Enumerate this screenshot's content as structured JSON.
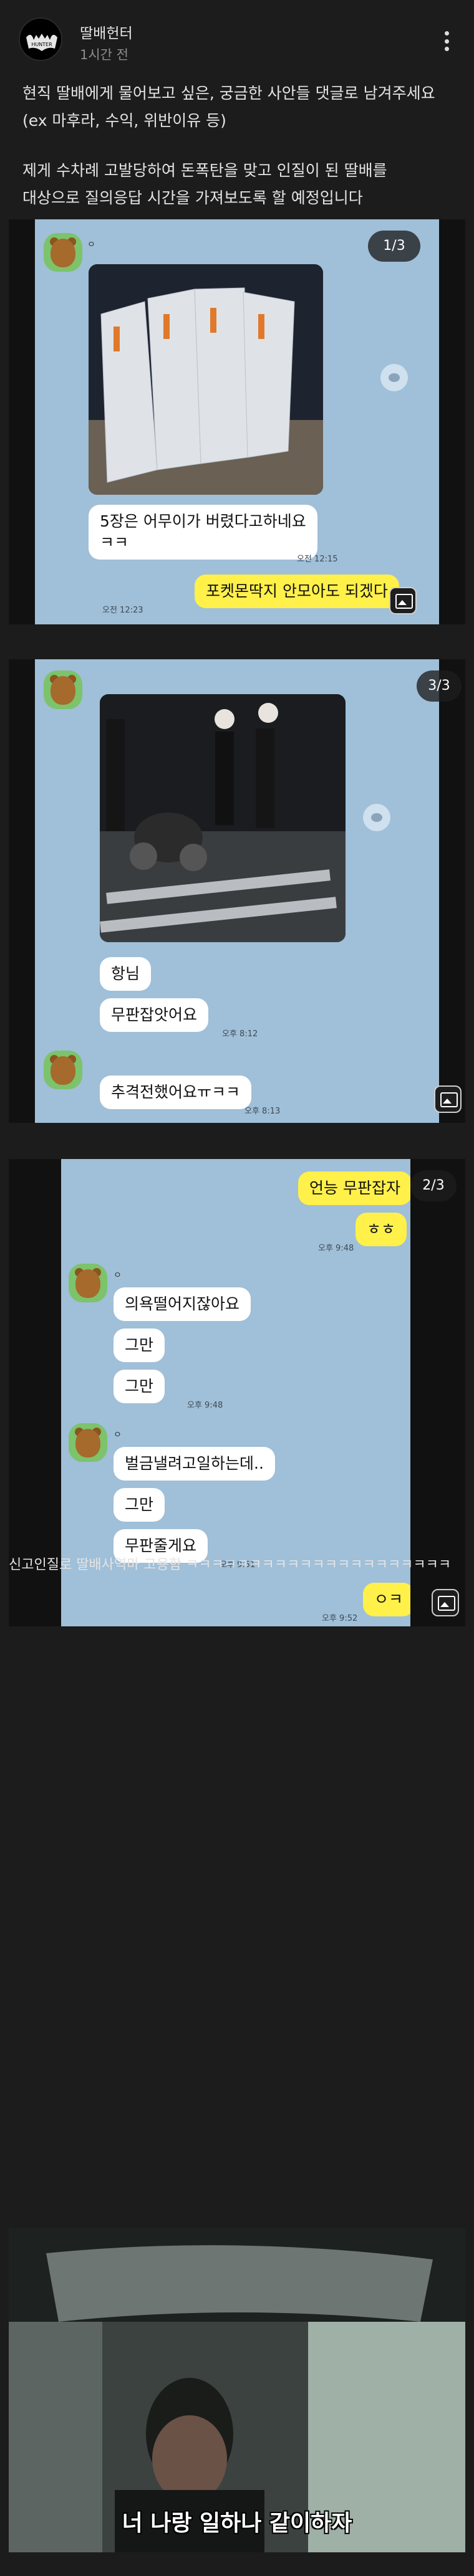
{
  "post": {
    "author": "딸배헌터",
    "time": "1시간 전",
    "intro_1": "현직 딸배에게 물어보고 싶은, 궁금한 사안들 댓글로 남겨주세요",
    "intro_2": "(ex 마후라, 수익, 위반이유 등)",
    "intro_3": "제게 수차례 고발당하여 돈폭탄을 맞고 인질이 된 딸배를",
    "intro_4": "대상으로 질의응답 시간을 가져보도록 할 예정입니다",
    "closing_text": "신고인질로 딸배사역마 고용함 ㅋㅋㅋㅋㅋㅋㅋㅋㅋㅋㅋㅋㅋㅋㅋㅋㅋㅋㅋㅋㅋ",
    "video_subtitle": "너 나랑 일하나 같이하자"
  },
  "chat1": {
    "counter": "1/3",
    "sender": "ㅇ",
    "msg1": "5장은 어무이가 버렸다고하네요",
    "msg2": "ㅋㅋ",
    "time1": "오전 12:15",
    "mine1": "포켓몬딱지 안모아도 되겠다",
    "time2": "오전 12:23"
  },
  "chat2": {
    "counter": "3/3",
    "sender": "ㅇ",
    "msg1": "항님",
    "msg2": "무판잡앗어요",
    "time1": "오후 8:12",
    "msg3": "추격전했어요ㅠㅋㅋ",
    "time2": "오후 8:13"
  },
  "chat3": {
    "counter": "2/3",
    "mine1": "언능 무판잡자",
    "mine2": "ㅎㅎ",
    "time0": "오후 9:48",
    "sender": "ㅇ",
    "msg1": "의욕떨어지잖아요",
    "msg2": "그만",
    "msg3": "그만",
    "time1": "오후 9:48",
    "msg4": "벌금낼려고일하는데..",
    "msg5": "그만",
    "msg6": "무판줄게요",
    "time2": "오후 9:51",
    "mine3": "ㅇㅋ",
    "time3": "오후 9:52"
  },
  "colors": {
    "background": "#1c1c1c",
    "chat_bg": "#a0bfd8",
    "my_bubble": "#fff04a"
  }
}
